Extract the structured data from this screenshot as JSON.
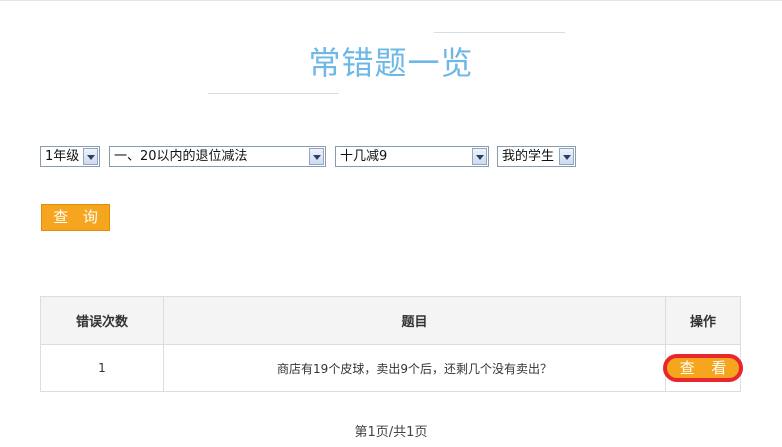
{
  "title": "常错题一览",
  "filters": {
    "grade": "1年级",
    "unit": "一、20以内的退位减法",
    "topic": "十几减9",
    "students": "我的学生"
  },
  "query_button": "查 询",
  "table": {
    "headers": [
      "错误次数",
      "题目",
      "操作"
    ],
    "rows": [
      {
        "count": "1",
        "question": "商店有19个皮球，卖出9个后，还剩几个没有卖出？",
        "action": "查 看"
      }
    ]
  },
  "pagination": "第1页/共1页"
}
